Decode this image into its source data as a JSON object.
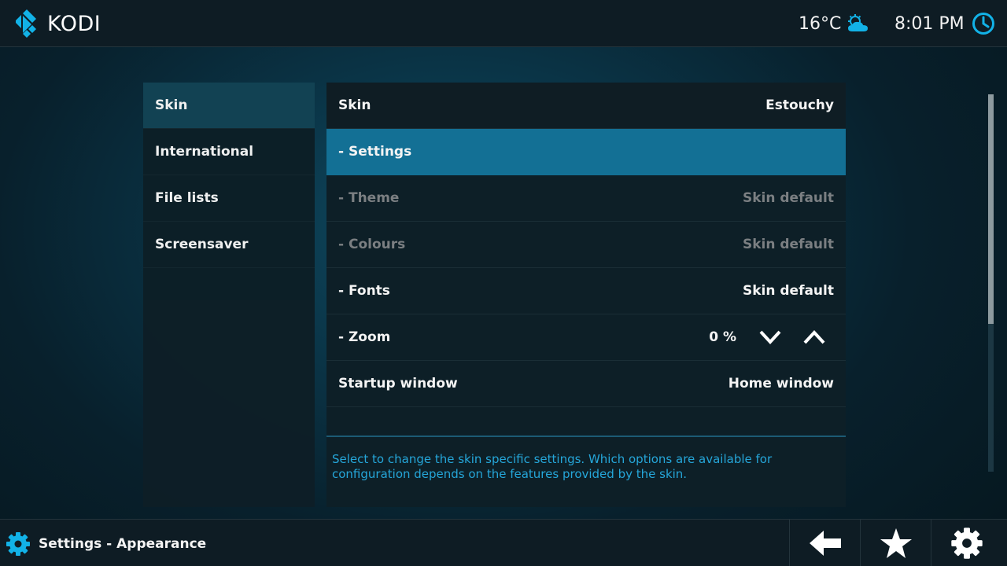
{
  "topbar": {
    "logo_text": "KODI",
    "temperature": "16°C",
    "weather_icon": "partly-cloudy-icon",
    "time": "8:01 PM",
    "clock_icon": "clock-icon"
  },
  "sidemenu": {
    "items": [
      {
        "label": "Skin",
        "active": true
      },
      {
        "label": "International",
        "active": false
      },
      {
        "label": "File lists",
        "active": false
      },
      {
        "label": "Screensaver",
        "active": false
      }
    ]
  },
  "settings": {
    "rows": [
      {
        "label": "Skin",
        "value": "Estouchy",
        "state": "header"
      },
      {
        "label": "- Settings",
        "value": "",
        "state": "focused"
      },
      {
        "label": "- Theme",
        "value": "Skin default",
        "state": "disabled"
      },
      {
        "label": "- Colours",
        "value": "Skin default",
        "state": "disabled"
      },
      {
        "label": "- Fonts",
        "value": "Skin default",
        "state": "normal"
      },
      {
        "label": "- Zoom",
        "value": "0 %",
        "state": "normal"
      },
      {
        "label": "Startup window",
        "value": "Home window",
        "state": "normal"
      }
    ],
    "description": "Select to change the skin specific settings. Which options are available for configuration depends on the features provided by the skin."
  },
  "bottombar": {
    "breadcrumb": "Settings - Appearance",
    "breadcrumb_icon": "gear-icon",
    "buttons": [
      "back-arrow-icon",
      "star-icon",
      "gear-icon"
    ]
  },
  "colors": {
    "accent": "#12b2e7",
    "focus": "#137095",
    "description_text": "#25a6d9"
  }
}
